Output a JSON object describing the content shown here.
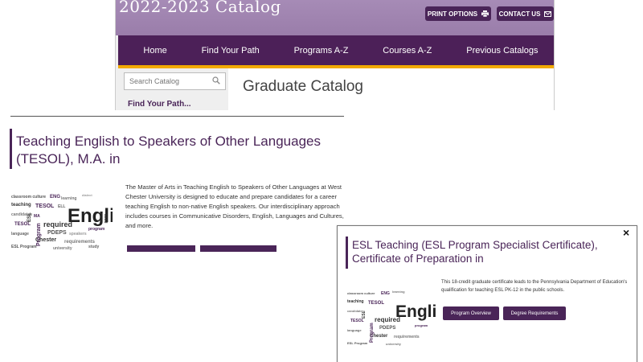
{
  "header": {
    "catalog_title": "2022-2023 Catalog",
    "print_label": "PRINT OPTIONS",
    "contact_label": "CONTACT US"
  },
  "nav": {
    "items": [
      {
        "label": "Home"
      },
      {
        "label": "Find Your Path"
      },
      {
        "label": "Programs A-Z"
      },
      {
        "label": "Courses A-Z"
      },
      {
        "label": "Previous Catalogs"
      }
    ]
  },
  "search": {
    "placeholder": "Search Catalog"
  },
  "sidebar": {
    "link": "Find Your Path..."
  },
  "page": {
    "heading": "Graduate Catalog"
  },
  "program": {
    "title": "Teaching English to Speakers of Other Languages (TESOL), M.A. in",
    "description": "The Master of Arts in Teaching English to Speakers of Other Languages at West Chester University is designed to educate and prepare candidates for a career teaching English to non-native English speakers. Our interdisciplinary approach includes courses in Communicative Disorders, English, Languages and Cultures, and more."
  },
  "popup": {
    "close": "×",
    "title": "ESL Teaching (ESL Program Specialist Certificate), Certificate of Preparation in",
    "description": "This 18-credit graduate certificate leads to the Pennsylvania Department of Education's qualification for teaching ESL PK-12 in the public schools.",
    "btn_overview": "Program Overview",
    "btn_requirements": "Degree Requirements"
  },
  "colors": {
    "brand_purple": "#4a2558",
    "banner_lavender": "#9a7daa",
    "accent_gold": "#f2a900"
  }
}
